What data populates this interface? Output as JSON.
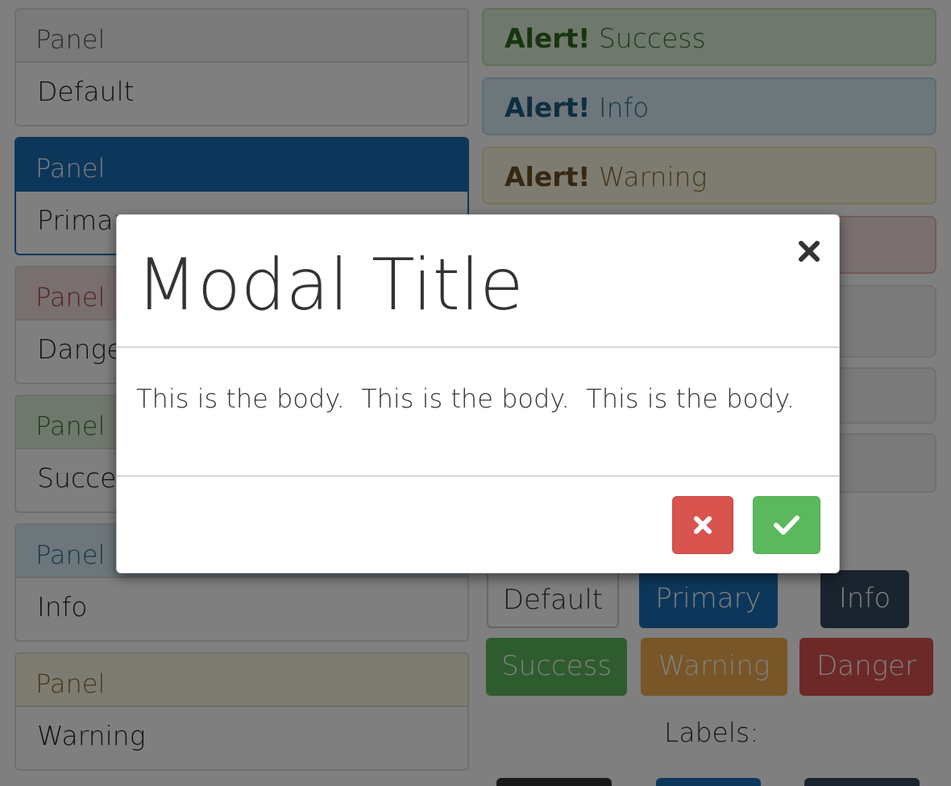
{
  "panels": [
    {
      "heading": "Panel",
      "body": "Default",
      "variant": "default"
    },
    {
      "heading": "Panel",
      "body": "Primary",
      "variant": "primary"
    },
    {
      "heading": "Panel",
      "body": "Danger",
      "variant": "danger"
    },
    {
      "heading": "Panel",
      "body": "Success",
      "variant": "success"
    },
    {
      "heading": "Panel",
      "body": "Info",
      "variant": "info"
    },
    {
      "heading": "Panel",
      "body": "Warning",
      "variant": "warning"
    }
  ],
  "alerts": [
    {
      "strong": "Alert!",
      "text": " Success",
      "variant": "success"
    },
    {
      "strong": "Alert!",
      "text": " Info",
      "variant": "info"
    },
    {
      "strong": "Alert!",
      "text": " Warning",
      "variant": "warning"
    }
  ],
  "buttons": {
    "default": "Default",
    "primary": "Primary",
    "info": "Info",
    "success": "Success",
    "warning": "Warning",
    "danger": "Danger"
  },
  "labels_heading": "Labels:",
  "modal": {
    "title": "Modal Title",
    "body": "This is the body.  This is the body.  This is the body.",
    "close_icon": "close-icon",
    "cancel_icon": "times-icon",
    "confirm_icon": "check-icon"
  },
  "colors": {
    "primary": "#1a6fb5",
    "danger": "#d9534f",
    "success": "#5cb85c",
    "warning": "#f0ad4e",
    "info": "#34495e"
  }
}
